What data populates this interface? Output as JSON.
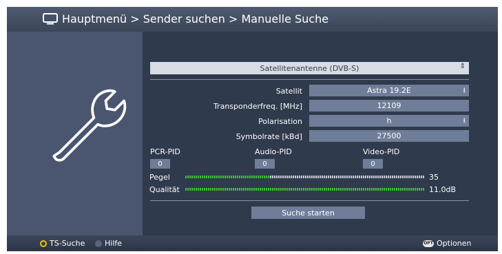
{
  "header": {
    "title": "Hauptmenü > Sender suchen > Manuelle Suche"
  },
  "form": {
    "antenna": {
      "value": "Satellitenantenne (DVB-S)"
    },
    "satellite": {
      "label": "Satellit",
      "value": "Astra 19.2E"
    },
    "frequency": {
      "label": "Transponderfreq. [MHz]",
      "value": "12109"
    },
    "polarisation": {
      "label": "Polarisation",
      "value": "h"
    },
    "symbolrate": {
      "label": "Symbolrate [kBd]",
      "value": "27500"
    }
  },
  "pids": {
    "pcr": {
      "label": "PCR-PID",
      "value": "0"
    },
    "audio": {
      "label": "Audio-PID",
      "value": "0"
    },
    "video": {
      "label": "Video-PID",
      "value": "0"
    }
  },
  "signal": {
    "level": {
      "label": "Pegel",
      "value_text": "35",
      "fraction": 0.35
    },
    "quality": {
      "label": "Qualität",
      "value_text": "11.0dB",
      "fraction": 1.0
    }
  },
  "actions": {
    "start_search": "Suche starten"
  },
  "footer": {
    "ts_search": "TS-Suche",
    "help": "Hilfe",
    "options_icon": "OPT",
    "options": "Optionen"
  },
  "colors": {
    "yellow_key": "#f2c200",
    "signal_green": "#3fbf35",
    "field_bg": "#6f7d98"
  }
}
